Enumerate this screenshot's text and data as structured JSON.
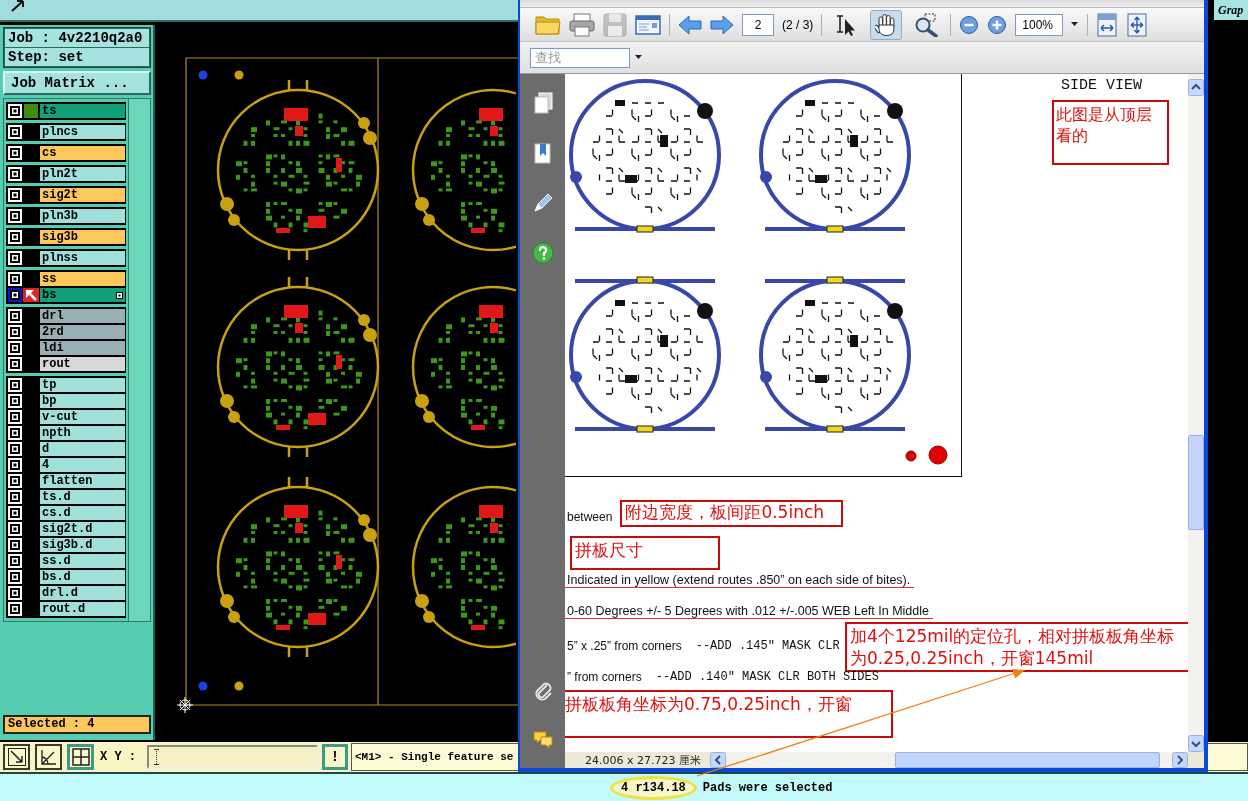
{
  "cam": {
    "job": "Job : 4v2210q2a0",
    "step": "Step: set",
    "job_matrix_button": "Job Matrix ...",
    "layer_frames": [
      {
        "layers": [
          {
            "name": "ts",
            "color": "#12a07c",
            "displayed": true,
            "work": false
          }
        ]
      },
      {
        "layers": [
          {
            "name": "plncs",
            "color": "#a0e0dc",
            "displayed": false,
            "work": false
          }
        ]
      },
      {
        "layers": [
          {
            "name": "cs",
            "color": "#fcc85c",
            "displayed": false,
            "work": false
          }
        ]
      },
      {
        "layers": [
          {
            "name": "pln2t",
            "color": "#a0e0dc",
            "displayed": false,
            "work": false
          }
        ]
      },
      {
        "layers": [
          {
            "name": "sig2t",
            "color": "#fcc85c",
            "displayed": false,
            "work": false
          }
        ]
      },
      {
        "layers": [
          {
            "name": "pln3b",
            "color": "#a0e0dc",
            "displayed": false,
            "work": false
          }
        ]
      },
      {
        "layers": [
          {
            "name": "sig3b",
            "color": "#fcc85c",
            "displayed": false,
            "work": false
          }
        ]
      },
      {
        "layers": [
          {
            "name": "plnss",
            "color": "#a0e0dc",
            "displayed": false,
            "work": false
          }
        ]
      },
      {
        "layers": [
          {
            "name": "ss",
            "color": "#fcc85c",
            "displayed": false,
            "work": false
          },
          {
            "name": "bs",
            "color": "#12a07c",
            "displayed": false,
            "work": true
          }
        ]
      },
      {
        "layers": [
          {
            "name": "drl",
            "color": "#9aaeb6",
            "displayed": false,
            "work": false
          },
          {
            "name": "2rd",
            "color": "#9aaeb6",
            "displayed": false,
            "work": false
          },
          {
            "name": "ldi",
            "color": "#9aaeb6",
            "displayed": false,
            "work": false
          },
          {
            "name": "rout",
            "color": "#d8d8d8",
            "displayed": false,
            "work": false
          }
        ]
      },
      {
        "layers": [
          {
            "name": "tp",
            "color": "#a0e0dc",
            "displayed": false,
            "work": false
          },
          {
            "name": "bp",
            "color": "#a0e0dc",
            "displayed": false,
            "work": false
          },
          {
            "name": "v-cut",
            "color": "#a0e0dc",
            "displayed": false,
            "work": false
          },
          {
            "name": "npth",
            "color": "#a0e0dc",
            "displayed": false,
            "work": false
          },
          {
            "name": "d",
            "color": "#a0e0dc",
            "displayed": false,
            "work": false
          },
          {
            "name": "4",
            "color": "#a0e0dc",
            "displayed": false,
            "work": false
          },
          {
            "name": "flatten",
            "color": "#a0e0dc",
            "displayed": false,
            "work": false
          },
          {
            "name": "ts.d",
            "color": "#a0e0dc",
            "displayed": false,
            "work": false
          },
          {
            "name": "cs.d",
            "color": "#a0e0dc",
            "displayed": false,
            "work": false
          },
          {
            "name": "sig2t.d",
            "color": "#a0e0dc",
            "displayed": false,
            "work": false
          },
          {
            "name": "sig3b.d",
            "color": "#a0e0dc",
            "displayed": false,
            "work": false
          },
          {
            "name": "ss.d",
            "color": "#a0e0dc",
            "displayed": false,
            "work": false
          },
          {
            "name": "bs.d",
            "color": "#a0e0dc",
            "displayed": false,
            "work": false
          },
          {
            "name": "drl.d",
            "color": "#a0e0dc",
            "displayed": false,
            "work": false
          },
          {
            "name": "rout.d",
            "color": "#a0e0dc",
            "displayed": false,
            "work": false
          }
        ]
      }
    ],
    "selected_count": "Selected : 4",
    "view_buttons": [
      {
        "kind": "diagonal-arrow",
        "on": false
      },
      {
        "kind": "angle",
        "on": false
      },
      {
        "kind": "grid",
        "on": true
      }
    ],
    "xy_label": "X Y :",
    "alert_button": "!",
    "message": "<M1> - Single feature se",
    "status": {
      "feature": "4 r134.18",
      "text": "Pads were selected"
    }
  },
  "right_panel": {
    "label": "Grap"
  },
  "pdf_viewer": {
    "file_buttons": [
      {
        "kind": "open",
        "disabled": false
      },
      {
        "kind": "print",
        "disabled": false
      },
      {
        "kind": "save",
        "disabled": true
      },
      {
        "kind": "email",
        "disabled": false
      }
    ],
    "page_number": "2",
    "page_count": "(2 / 3)",
    "tools": [
      {
        "kind": "select",
        "selected": false
      },
      {
        "kind": "hand",
        "selected": true
      },
      {
        "kind": "zoom",
        "selected": false
      }
    ],
    "zoom": "100%",
    "find": {
      "placeholder": "查找"
    },
    "page_heading": "SIDE VIEW",
    "heading_note": [
      "此图是从顶层",
      "看的"
    ],
    "body_lines": [
      {
        "kind": "labelled-note",
        "text": "between",
        "note": [
          "附边宽度，板间距0.5inch"
        ]
      },
      {
        "kind": "note",
        "note": [
          "拼板尺寸"
        ]
      },
      {
        "kind": "text",
        "text": "Indicated in yellow (extend routes .850” on each side of bites).",
        "struck": true
      },
      {
        "kind": "text",
        "text": "0-60 Degrees +/- 5 Degrees with .012 +/-.005 WEB Left In Middle",
        "struck": true
      },
      {
        "kind": "spec",
        "text": "5” x .25” from corners",
        "code": "--ADD .145\" MASK CLR",
        "struck": false,
        "note": [
          "加4个125mil的定位孔，相对拼板板角坐标",
          "为0.25,0.25inch，开窗145mil"
        ]
      },
      {
        "kind": "spec",
        "text": "” from corners",
        "code": "--ADD .140\" MASK CLR BOTH SIDES",
        "struck": false
      },
      {
        "kind": "note",
        "note": [
          "拼板板角坐标为0.75,0.25inch，开窗"
        ]
      }
    ],
    "page_size": "24.006 x 27.723 厘米"
  }
}
